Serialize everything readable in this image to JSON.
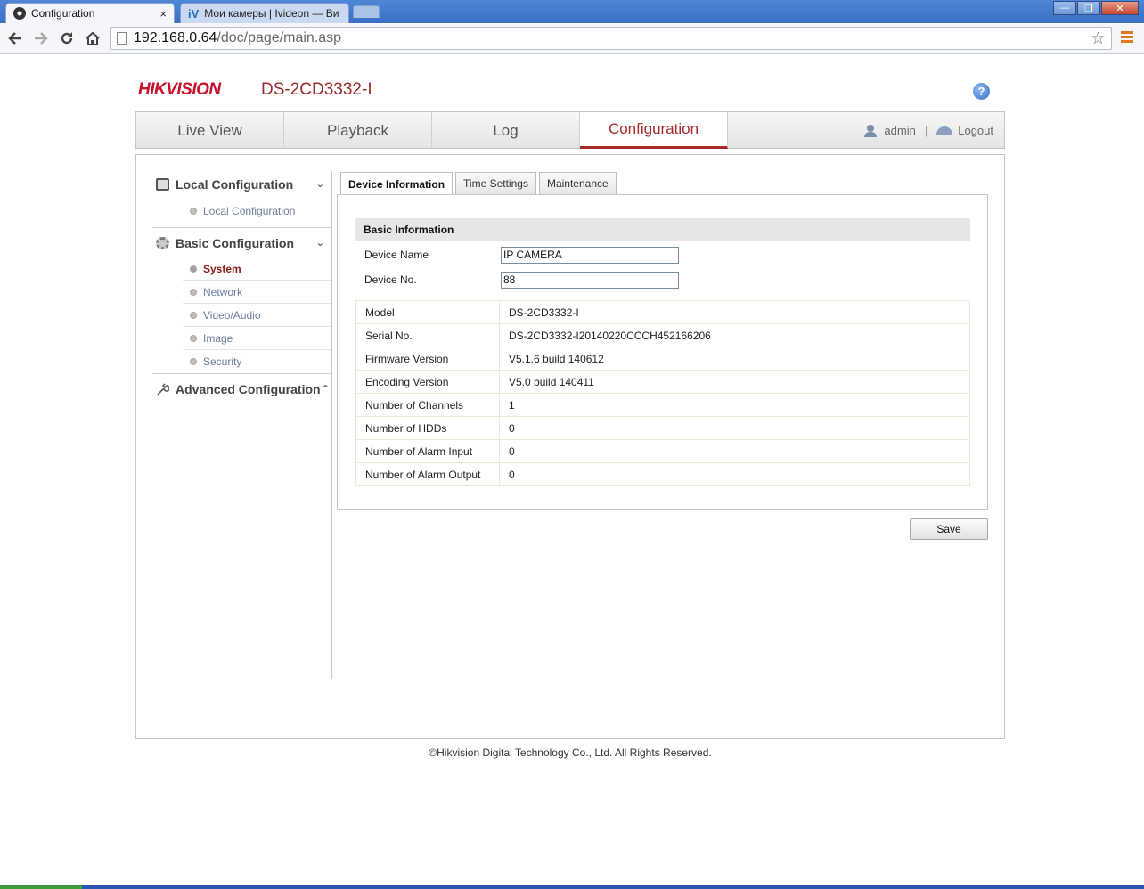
{
  "browser": {
    "tabs": [
      {
        "label": "Configuration",
        "close": "×"
      },
      {
        "label": "Мои камеры | Ivideon — Ви",
        "favicon": "iV"
      }
    ],
    "url_host": "192.168.0.64",
    "url_path": "/doc/page/main.asp",
    "win_minimize": "—",
    "win_restore": "❐",
    "win_close": "✕"
  },
  "header": {
    "logo": "HIKVISION",
    "model": "DS-2CD3332-I",
    "help": "?"
  },
  "nav": {
    "items": [
      "Live View",
      "Playback",
      "Log",
      "Configuration"
    ],
    "active": "Configuration",
    "user": "admin",
    "separator": "|",
    "logout": "Logout"
  },
  "sidebar": {
    "sections": [
      {
        "title": "Local Configuration",
        "icon": "monitor-icon",
        "chevron": "⌄",
        "items": [
          "Local Configuration"
        ]
      },
      {
        "title": "Basic Configuration",
        "icon": "gear-icon",
        "chevron": "⌄",
        "items": [
          "System",
          "Network",
          "Video/Audio",
          "Image",
          "Security"
        ]
      },
      {
        "title": "Advanced Configuration",
        "icon": "wrench-icon",
        "chevron": "⌃",
        "items": []
      }
    ],
    "active_item": "System"
  },
  "tabs": [
    "Device Information",
    "Time Settings",
    "Maintenance"
  ],
  "basic_info": {
    "title": "Basic Information",
    "device_name_label": "Device Name",
    "device_name_value": "IP CAMERA",
    "device_no_label": "Device No.",
    "device_no_value": "88",
    "rows": [
      {
        "label": "Model",
        "value": "DS-2CD3332-I"
      },
      {
        "label": "Serial No.",
        "value": "DS-2CD3332-I20140220CCCH452166206"
      },
      {
        "label": "Firmware Version",
        "value": "V5.1.6 build 140612"
      },
      {
        "label": "Encoding Version",
        "value": "V5.0 build 140411"
      },
      {
        "label": "Number of Channels",
        "value": "1"
      },
      {
        "label": "Number of HDDs",
        "value": "0"
      },
      {
        "label": "Number of Alarm Input",
        "value": "0"
      },
      {
        "label": "Number of Alarm Output",
        "value": "0"
      }
    ]
  },
  "save_label": "Save",
  "footer": "©Hikvision Digital Technology Co., Ltd. All Rights Reserved.",
  "colors": {
    "accent": "#a52a2a",
    "link": "#6b7d9a",
    "brand": "#c8102e"
  }
}
